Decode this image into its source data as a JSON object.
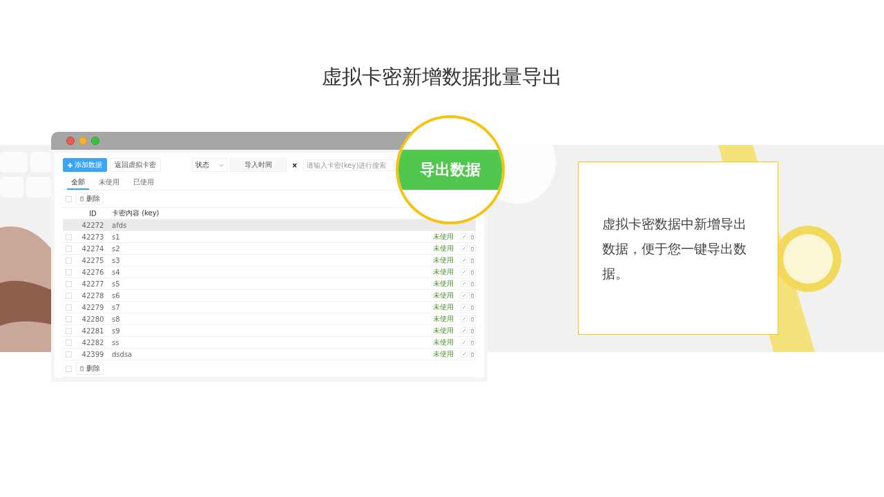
{
  "title": "虚拟卡密新增数据批量导出",
  "window": {
    "toolbar": {
      "add_button": "添加数据",
      "back_button": "返回虚拟卡密",
      "status_select": "状态",
      "date_field": "导入时间",
      "clear_button": "×",
      "search_placeholder": "请输入卡密(key)进行搜索"
    },
    "tabs": [
      {
        "label": "全部",
        "selected": true
      },
      {
        "label": "未使用",
        "selected": false
      },
      {
        "label": "已使用",
        "selected": false
      }
    ],
    "bulk_top": {
      "checked": false,
      "delete_button": "删除"
    },
    "columns": [
      "ID",
      "卡密内容 (key)"
    ],
    "rows": [
      {
        "id": "42272",
        "key": "afds",
        "highlighted": true
      },
      {
        "id": "42273",
        "key": "s1",
        "status": "未使用",
        "highlighted": false,
        "checked": false
      },
      {
        "id": "42274",
        "key": "s2",
        "status": "未使用",
        "highlighted": false,
        "checked": false
      },
      {
        "id": "42275",
        "key": "s3",
        "status": "未使用",
        "highlighted": false,
        "checked": false
      },
      {
        "id": "42276",
        "key": "s4",
        "status": "未使用",
        "highlighted": false,
        "checked": false
      },
      {
        "id": "42277",
        "key": "s5",
        "status": "未使用",
        "highlighted": false,
        "checked": false
      },
      {
        "id": "42278",
        "key": "s6",
        "status": "未使用",
        "highlighted": false,
        "checked": false
      },
      {
        "id": "42279",
        "key": "s7",
        "status": "未使用",
        "highlighted": false,
        "checked": false
      },
      {
        "id": "42280",
        "key": "s8",
        "status": "未使用",
        "highlighted": false,
        "checked": false
      },
      {
        "id": "42281",
        "key": "s9",
        "status": "未使用",
        "highlighted": false,
        "checked": false
      },
      {
        "id": "42282",
        "key": "ss",
        "status": "未使用",
        "highlighted": false,
        "checked": false
      },
      {
        "id": "42399",
        "key": "dsdsa",
        "status": "未使用",
        "highlighted": false,
        "checked": false
      }
    ],
    "bulk_bottom": {
      "checked": false,
      "delete_button": "删除"
    }
  },
  "magnifier": {
    "label": "导出数据"
  },
  "description": "虚拟卡密数据中新增导出数据，便于您一键导出数据。"
}
